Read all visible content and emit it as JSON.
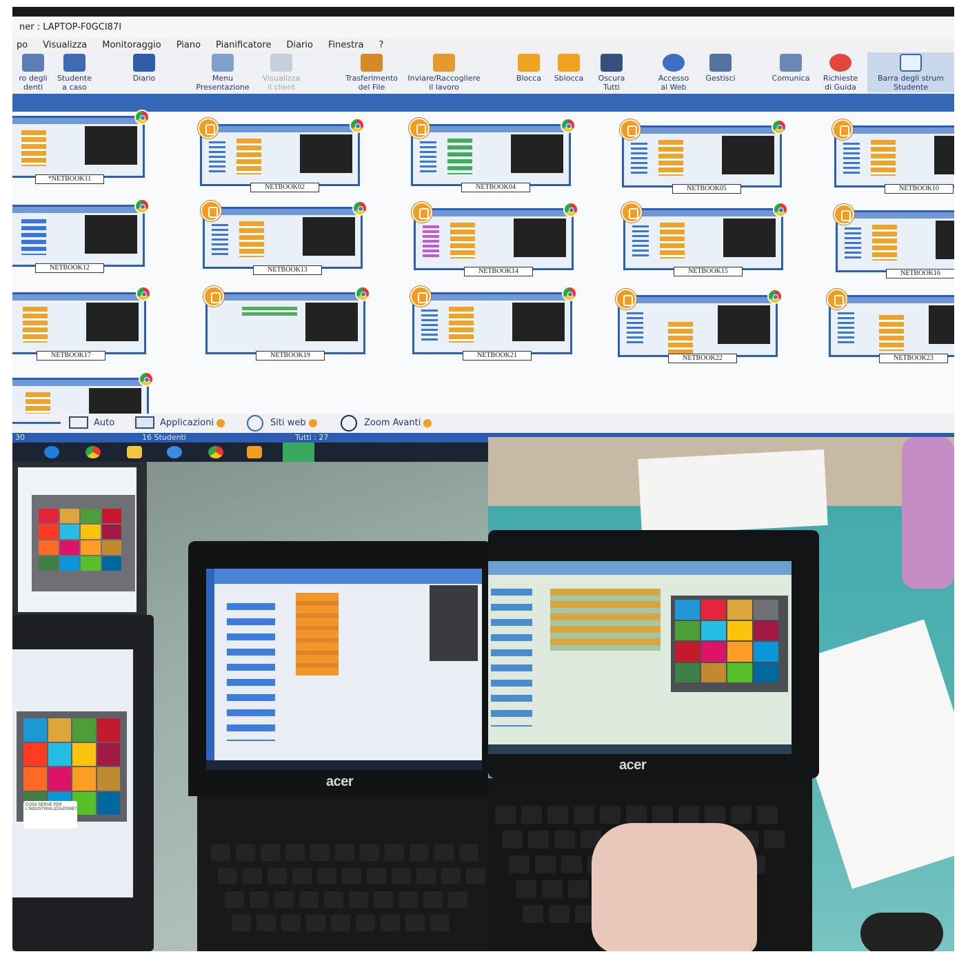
{
  "window": {
    "title": "ner : LAPTOP-F0GCI87I"
  },
  "menu": [
    "po",
    "Visualizza",
    "Monitoraggio",
    "Piano",
    "Pianificatore",
    "Diario",
    "Finestra",
    "?"
  ],
  "toolbar": {
    "items": [
      {
        "label": "ro degli\ndenti",
        "icon": "students-icon"
      },
      {
        "label": "Studente\na caso",
        "icon": "random-student-icon"
      },
      {
        "label": "Diario",
        "icon": "diary-icon"
      },
      {
        "label": "Menu\nPresentazione",
        "icon": "presentation-icon"
      },
      {
        "label": "Visualizza\nil client",
        "icon": "view-client-icon"
      },
      {
        "label": "Trasferimento\ndel File",
        "icon": "file-transfer-icon"
      },
      {
        "label": "Inviare/Raccogliere\nil lavoro",
        "icon": "briefcase-icon"
      },
      {
        "label": "Blocca",
        "icon": "lock-icon"
      },
      {
        "label": "Sblocca",
        "icon": "unlock-icon"
      },
      {
        "label": "Oscura\nTutti",
        "icon": "blank-screen-icon"
      },
      {
        "label": "Accesso\nal Web",
        "icon": "globe-icon"
      },
      {
        "label": "Gestisci",
        "icon": "manage-icon"
      },
      {
        "label": "Comunica",
        "icon": "chat-icon"
      },
      {
        "label": "Richieste\ndi Guida",
        "icon": "lifebuoy-icon"
      },
      {
        "label": "Barra degli strum\nStudente",
        "icon": "student-toolbar-icon"
      }
    ]
  },
  "clients": [
    {
      "name": "*NETBOOK11"
    },
    {
      "name": "NETBOOK02"
    },
    {
      "name": "NETBOOK04"
    },
    {
      "name": "NETBOOK05"
    },
    {
      "name": "NETBOOK10"
    },
    {
      "name": "NETBOOK12"
    },
    {
      "name": "NETBOOK13"
    },
    {
      "name": "NETBOOK14"
    },
    {
      "name": "NETBOOK15"
    },
    {
      "name": "NETBOOK16"
    },
    {
      "name": "NETBOOK17"
    },
    {
      "name": "NETBOOK19"
    },
    {
      "name": "NETBOOK21"
    },
    {
      "name": "NETBOOK22"
    },
    {
      "name": "NETBOOK23"
    },
    {
      "name": ""
    }
  ],
  "bottombar": {
    "auto": "Auto",
    "applicazioni": "Applicazioni",
    "siti_web": "Siti web",
    "zoom": "Zoom Avanti"
  },
  "status": {
    "left": "30",
    "students": "16 Studenti",
    "total": "Tutti : 27"
  },
  "photos": {
    "laptop_brand": "acer",
    "callout_text": "COSA SERVE PER L'INDUSTRIALIZZAZIONE?"
  },
  "colors": {
    "toolbar_blue": "#3467b6",
    "thumb_border": "#2d5eb1",
    "badge_orange": "#f29d1f",
    "scratch_orange": "#f0962a",
    "desk_teal": "#3fa7ab"
  }
}
